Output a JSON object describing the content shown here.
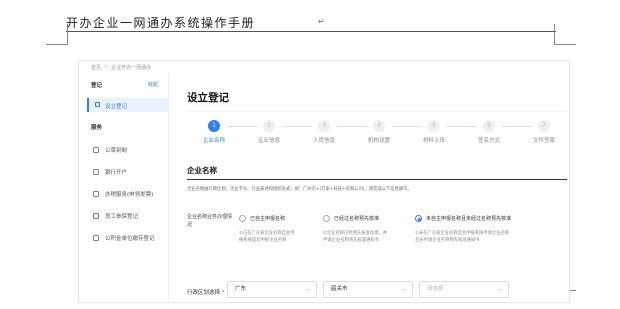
{
  "document": {
    "header": "开办企业一网通办系统操作手册",
    "mark": "↵"
  },
  "breadcrumb": [
    "首页",
    "企业开办一网通办"
  ],
  "sidebar": {
    "head": "登记",
    "collapse": "收起",
    "active_item": "设立登记",
    "group": "服务",
    "items": [
      "公章刻制",
      "银行开户",
      "办税服务(申领发票)",
      "员工参保登记",
      "公积金单位缴存登记"
    ]
  },
  "main": {
    "title": "设立登记",
    "steps": [
      {
        "num": "1",
        "label": "企业名称",
        "active": true
      },
      {
        "num": "2",
        "label": "企业信息",
        "active": false
      },
      {
        "num": "3",
        "label": "人员信息",
        "active": false
      },
      {
        "num": "4",
        "label": "机构设置",
        "active": false
      },
      {
        "num": "5",
        "label": "材料上传",
        "active": false
      },
      {
        "num": "6",
        "label": "签名方式",
        "active": false
      },
      {
        "num": "7",
        "label": "文件签章",
        "active": false
      }
    ],
    "section_title": "企业名称",
    "section_note": "企业名称由行政区划、企业字号、行业表述和组织形式，如：广州市+(万家+科技+有限公司)，请完成以下信息填写。",
    "question_label": "企业名称业务办理情况",
    "options": [
      {
        "label": "已自主申报名称",
        "desc": [
          "①已在广东省企业名称自主申",
          "报系统成功申报企业名称"
        ],
        "checked": false
      },
      {
        "label": "已经过名称预先核准",
        "desc": [
          "①企业名称已经预先核准办理，并",
          "申请企业名称预先核准通知书"
        ],
        "checked": false
      },
      {
        "label": "未自主申报名称且未经过名称预先核准",
        "desc": [
          "①未在广东省企业名称自主申报系统申请企业名称",
          "且未申请企业名称预先核准通知书"
        ],
        "checked": true
      }
    ],
    "select_label": "行政区划选择",
    "select_required": "*",
    "selects": [
      {
        "value": "广东",
        "chev": "⌄"
      },
      {
        "value": "韶关市",
        "chev": "⌄"
      },
      {
        "value": "请选择",
        "chev": "⌄"
      }
    ]
  },
  "colors": {
    "accent": "#2f7ff3",
    "required": "#e54545"
  }
}
